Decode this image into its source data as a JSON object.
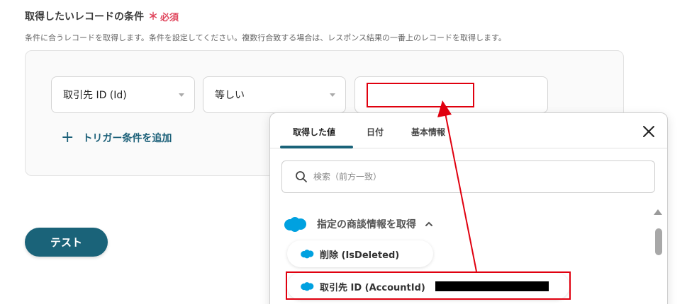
{
  "section": {
    "title": "取得したいレコードの条件",
    "required_star": "＊",
    "required_label": "必須",
    "description": "条件に合うレコードを取得します。条件を設定してください。複数行合致する場合は、レスポンス結果の一番上のレコードを取得します。"
  },
  "condition": {
    "field_value": "取引先 ID (Id)",
    "operator_value": "等しい",
    "value_input": ""
  },
  "add_trigger": {
    "plus": "+",
    "label": "トリガー条件を追加"
  },
  "test_button": {
    "label": "テスト"
  },
  "popup": {
    "tabs": [
      {
        "label": "取得した値"
      },
      {
        "label": "日付"
      },
      {
        "label": "基本情報"
      }
    ],
    "search_placeholder": "検索（前方一致）",
    "group_label": "指定の商談情報を取得",
    "items": [
      {
        "label": "削除 (IsDeleted)"
      },
      {
        "label": "取引先 ID (AccountId)"
      }
    ]
  },
  "colors": {
    "accent": "#1a6379",
    "required": "#e0475e",
    "highlight": "#e0000f",
    "salesforce": "#00a1e0"
  },
  "icons": {
    "close": "close-icon",
    "search": "search-icon",
    "caret": "chevron-up-icon",
    "brand": "salesforce-cloud-icon"
  }
}
